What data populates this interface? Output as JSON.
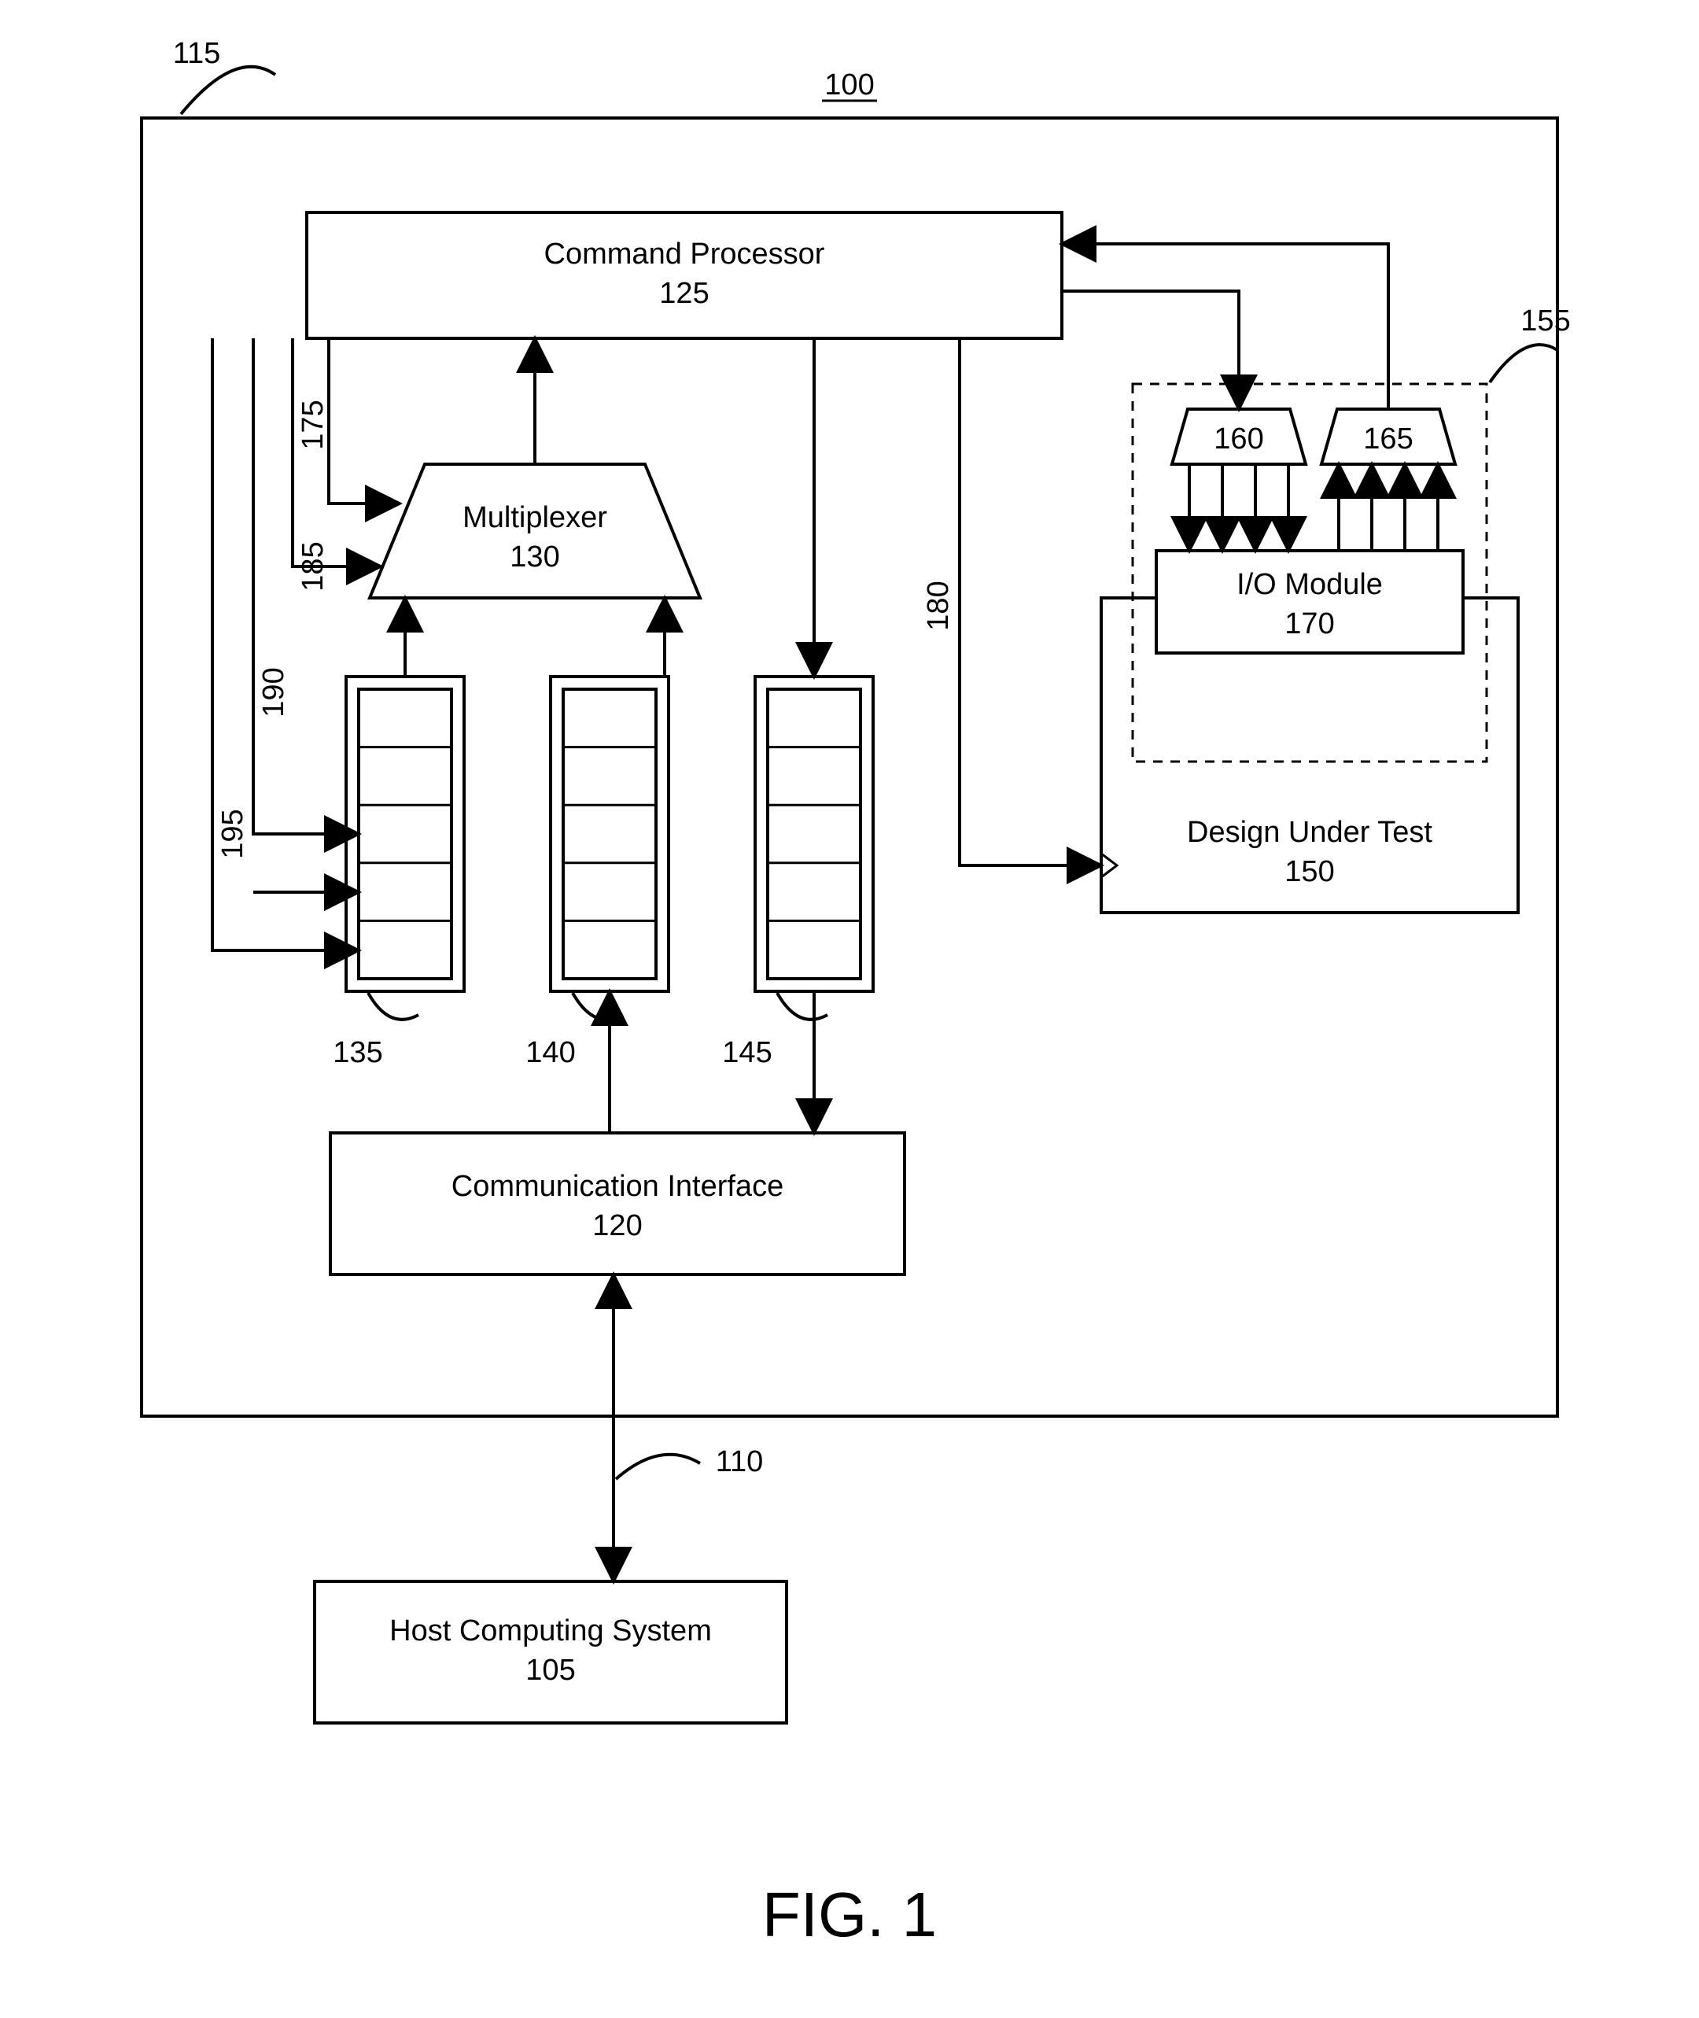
{
  "figure": {
    "title": "FIG. 1",
    "ref_top": "100",
    "refs": {
      "outer": "115",
      "comm_link": "110",
      "io_group": "155"
    },
    "blocks": {
      "command_processor": {
        "label": "Command Processor",
        "ref": "125"
      },
      "multiplexer": {
        "label": "Multiplexer",
        "ref": "130"
      },
      "comm_interface": {
        "label": "Communication Interface",
        "ref": "120"
      },
      "host": {
        "label": "Host Computing System",
        "ref": "105"
      },
      "design_under_test": {
        "label": "Design Under Test",
        "ref": "150"
      },
      "io_module": {
        "label": "I/O Module",
        "ref": "170"
      },
      "trap_left": {
        "ref": "160"
      },
      "trap_right": {
        "ref": "165"
      }
    },
    "buffer_refs": {
      "a": "135",
      "b": "140",
      "c": "145"
    },
    "wire_refs": {
      "w175": "175",
      "w180": "180",
      "w185": "185",
      "w190": "190",
      "w195": "195"
    }
  }
}
